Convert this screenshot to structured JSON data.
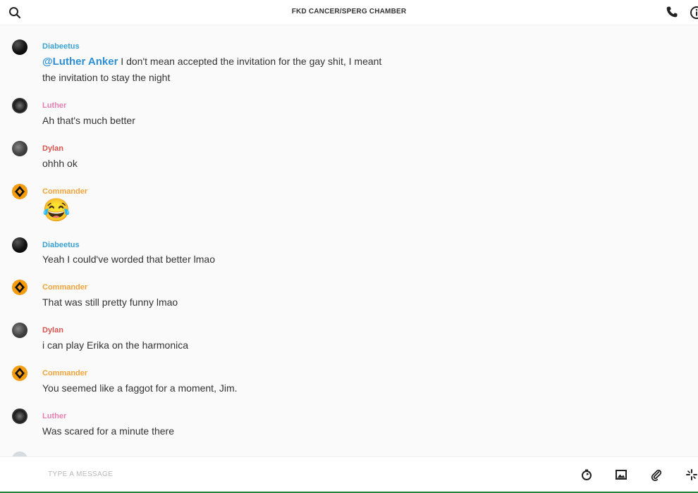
{
  "header": {
    "title": "FKD CANCER/SPERG CHAMBER",
    "search_icon": "search-icon",
    "call_icon": "phone-icon",
    "info_icon": "info-icon"
  },
  "messages": [
    {
      "sender": "Diabeetus",
      "mention": "@Luther Anker",
      "line1": " I don't mean accepted the invitation for the gay shit, I meant",
      "line2": "the invitation to stay the night"
    },
    {
      "sender": "Luther",
      "text": "Ah that's much better"
    },
    {
      "sender": "Dylan",
      "text": "ohhh ok"
    },
    {
      "sender": "Commander",
      "emoji": "😂"
    },
    {
      "sender": "Diabeetus",
      "text": "Yeah I could've worded that better lmao"
    },
    {
      "sender": "Commander",
      "text": "That was still pretty funny lmao"
    },
    {
      "sender": "Dylan",
      "text": "i can play Erika on the harmonica"
    },
    {
      "sender": "Commander",
      "text": "You seemed like a faggot for a moment, Jim."
    },
    {
      "sender": "Luther",
      "text": "Was scared for a minute there"
    }
  ],
  "composer": {
    "placeholder": "TYPE A MESSAGE",
    "tools": [
      "timer-icon",
      "image-icon",
      "attachment-icon",
      "sparkle-icon"
    ]
  },
  "colors": {
    "diabeetus": "#3aa1d0",
    "luther": "#e87fb3",
    "dylan": "#d9534f",
    "commander": "#f0a33a",
    "mention": "#2b8fd6"
  }
}
